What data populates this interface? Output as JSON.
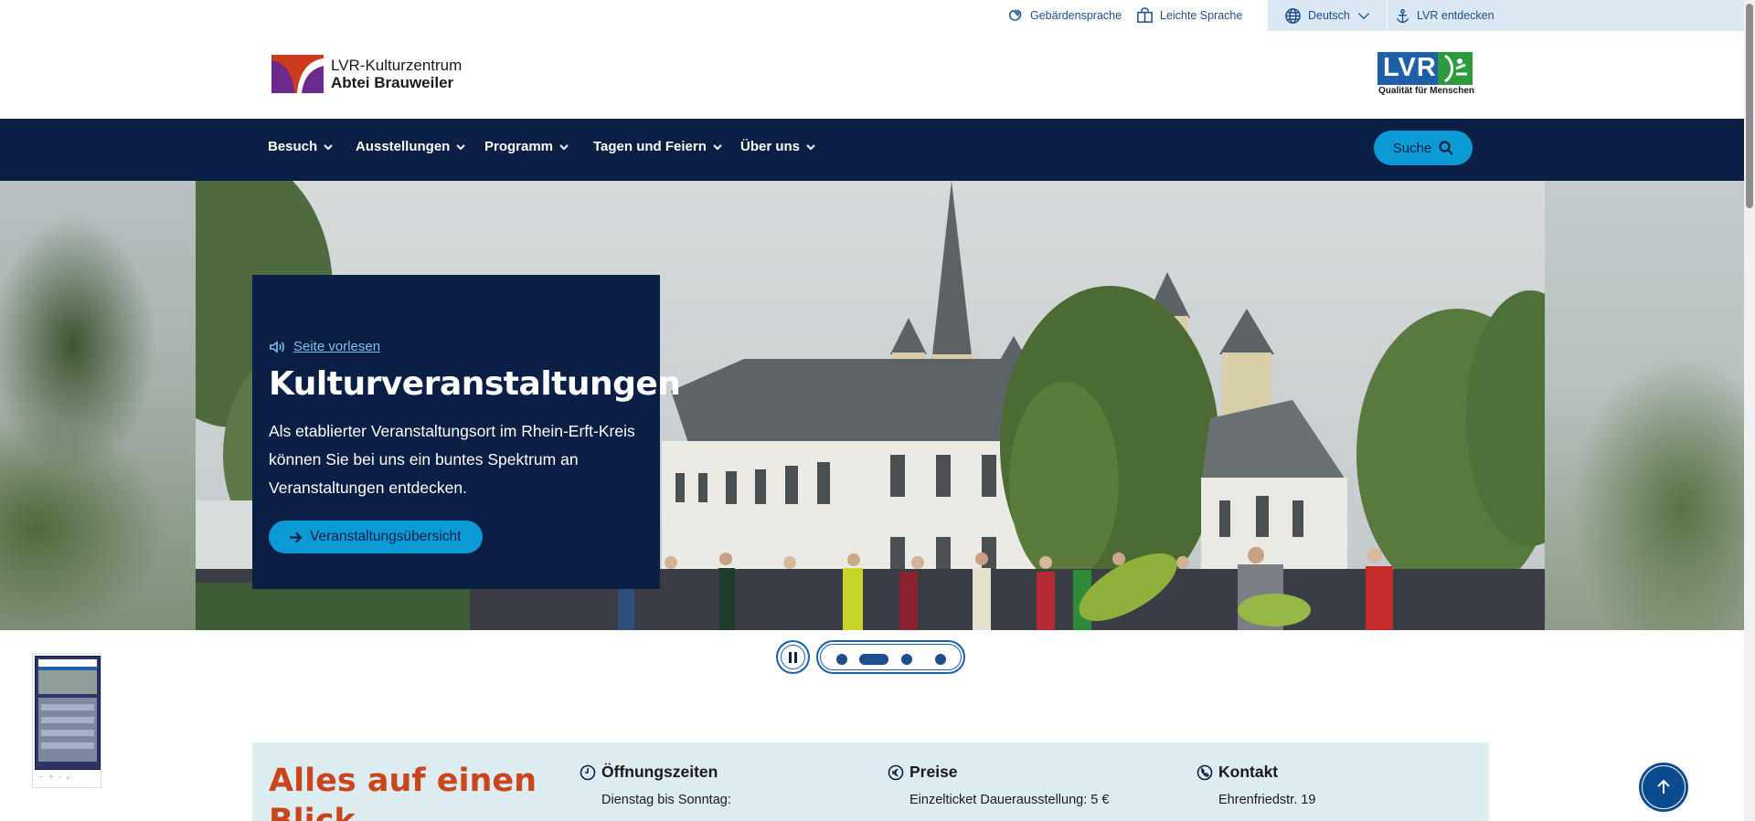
{
  "utility": {
    "sign_language": "Gebärdensprache",
    "easy_language": "Leichte Sprache",
    "language": "Deutsch",
    "discover": "LVR entdecken"
  },
  "header": {
    "brand_line1": "LVR-Kulturzentrum",
    "brand_line2": "Abtei Brauweiler",
    "lvr_letters": "LVR",
    "lvr_tagline": "Qualität für Menschen"
  },
  "nav": {
    "items": [
      {
        "label": "Besuch"
      },
      {
        "label": "Ausstellungen"
      },
      {
        "label": "Programm"
      },
      {
        "label": "Tagen und Feiern"
      },
      {
        "label": "Über uns"
      }
    ],
    "search_label": "Suche"
  },
  "hero": {
    "read_aloud": "Seite vorlesen",
    "title": "Kulturveranstaltungen",
    "text": "Als etablierter Veranstaltungsort im Rhein-Erft-Kreis können Sie bei uns ein buntes Spektrum an Veranstaltungen entdecken.",
    "button": "Veranstaltungsübersicht"
  },
  "slider": {
    "slide_count": 4,
    "active_slide": 2
  },
  "info": {
    "title": "Alles auf einen Blick",
    "columns": [
      {
        "icon": "clock-icon",
        "heading": "Öffnungszeiten",
        "line": "Dienstag bis Sonntag:"
      },
      {
        "icon": "euro-icon",
        "heading": "Preise",
        "line": "Einzelticket Dauerausstellung: 5 €"
      },
      {
        "icon": "phone-icon",
        "heading": "Kontakt",
        "line": "Ehrenfriedstr. 19"
      }
    ]
  },
  "colors": {
    "navy": "#0b1f45",
    "accent_blue": "#0a9bd6",
    "link_blue": "#1d4f8c",
    "info_bg": "#dcecf1",
    "title_orange": "#c9461c"
  }
}
